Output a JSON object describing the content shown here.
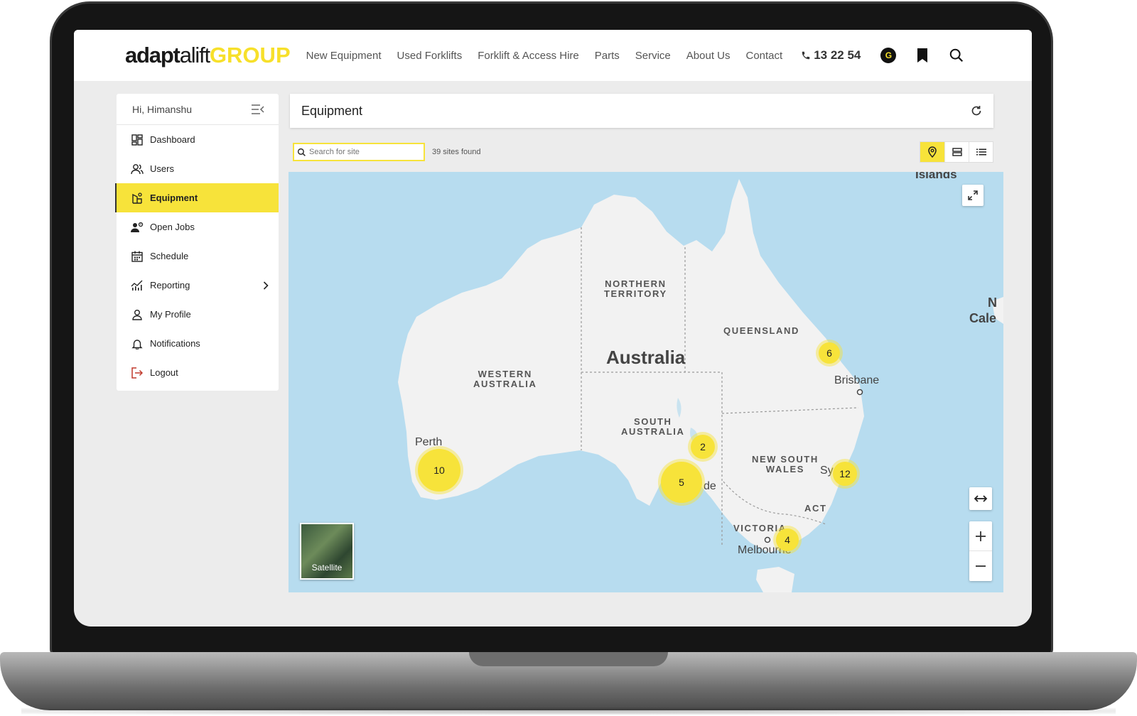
{
  "nav": {
    "logo_part1": "adapt",
    "logo_part2": "alift",
    "logo_part3": "GROUP",
    "links": [
      "New Equipment",
      "Used Forklifts",
      "Forklift & Access Hire",
      "Parts",
      "Service",
      "About Us",
      "Contact"
    ],
    "phone": "13 22 54",
    "badge": "G"
  },
  "sidebar": {
    "greeting": "Hi, Himanshu",
    "items": [
      {
        "label": "Dashboard"
      },
      {
        "label": "Users"
      },
      {
        "label": "Equipment"
      },
      {
        "label": "Open Jobs"
      },
      {
        "label": "Schedule"
      },
      {
        "label": "Reporting"
      },
      {
        "label": "My Profile"
      },
      {
        "label": "Notifications"
      },
      {
        "label": "Logout"
      }
    ]
  },
  "main": {
    "title": "Equipment",
    "search_placeholder": "Search for site",
    "sites_found": "39 sites found"
  },
  "map": {
    "country": "Australia",
    "regions": {
      "nt": "NORTHERN\nTERRITORY",
      "qld": "QUEENSLAND",
      "wa": "WESTERN\nAUSTRALIA",
      "sa": "SOUTH\nAUSTRALIA",
      "nsw": "NEW SOUTH\nWALES",
      "act": "ACT",
      "vic": "VICTORIA"
    },
    "cities": {
      "perth": "Perth",
      "brisbane": "Brisbane",
      "melbourne": "Melbourne",
      "sydney": "Sy",
      "adelaide": "de",
      "islands": "Islands",
      "nc1": "N",
      "nc2": "Cale"
    },
    "clusters": [
      "10",
      "5",
      "2",
      "6",
      "12",
      "4"
    ],
    "satellite_label": "Satellite"
  },
  "colors": {
    "accent": "#f7e33a",
    "water": "#b7dcef",
    "land": "#f2f2f2"
  }
}
